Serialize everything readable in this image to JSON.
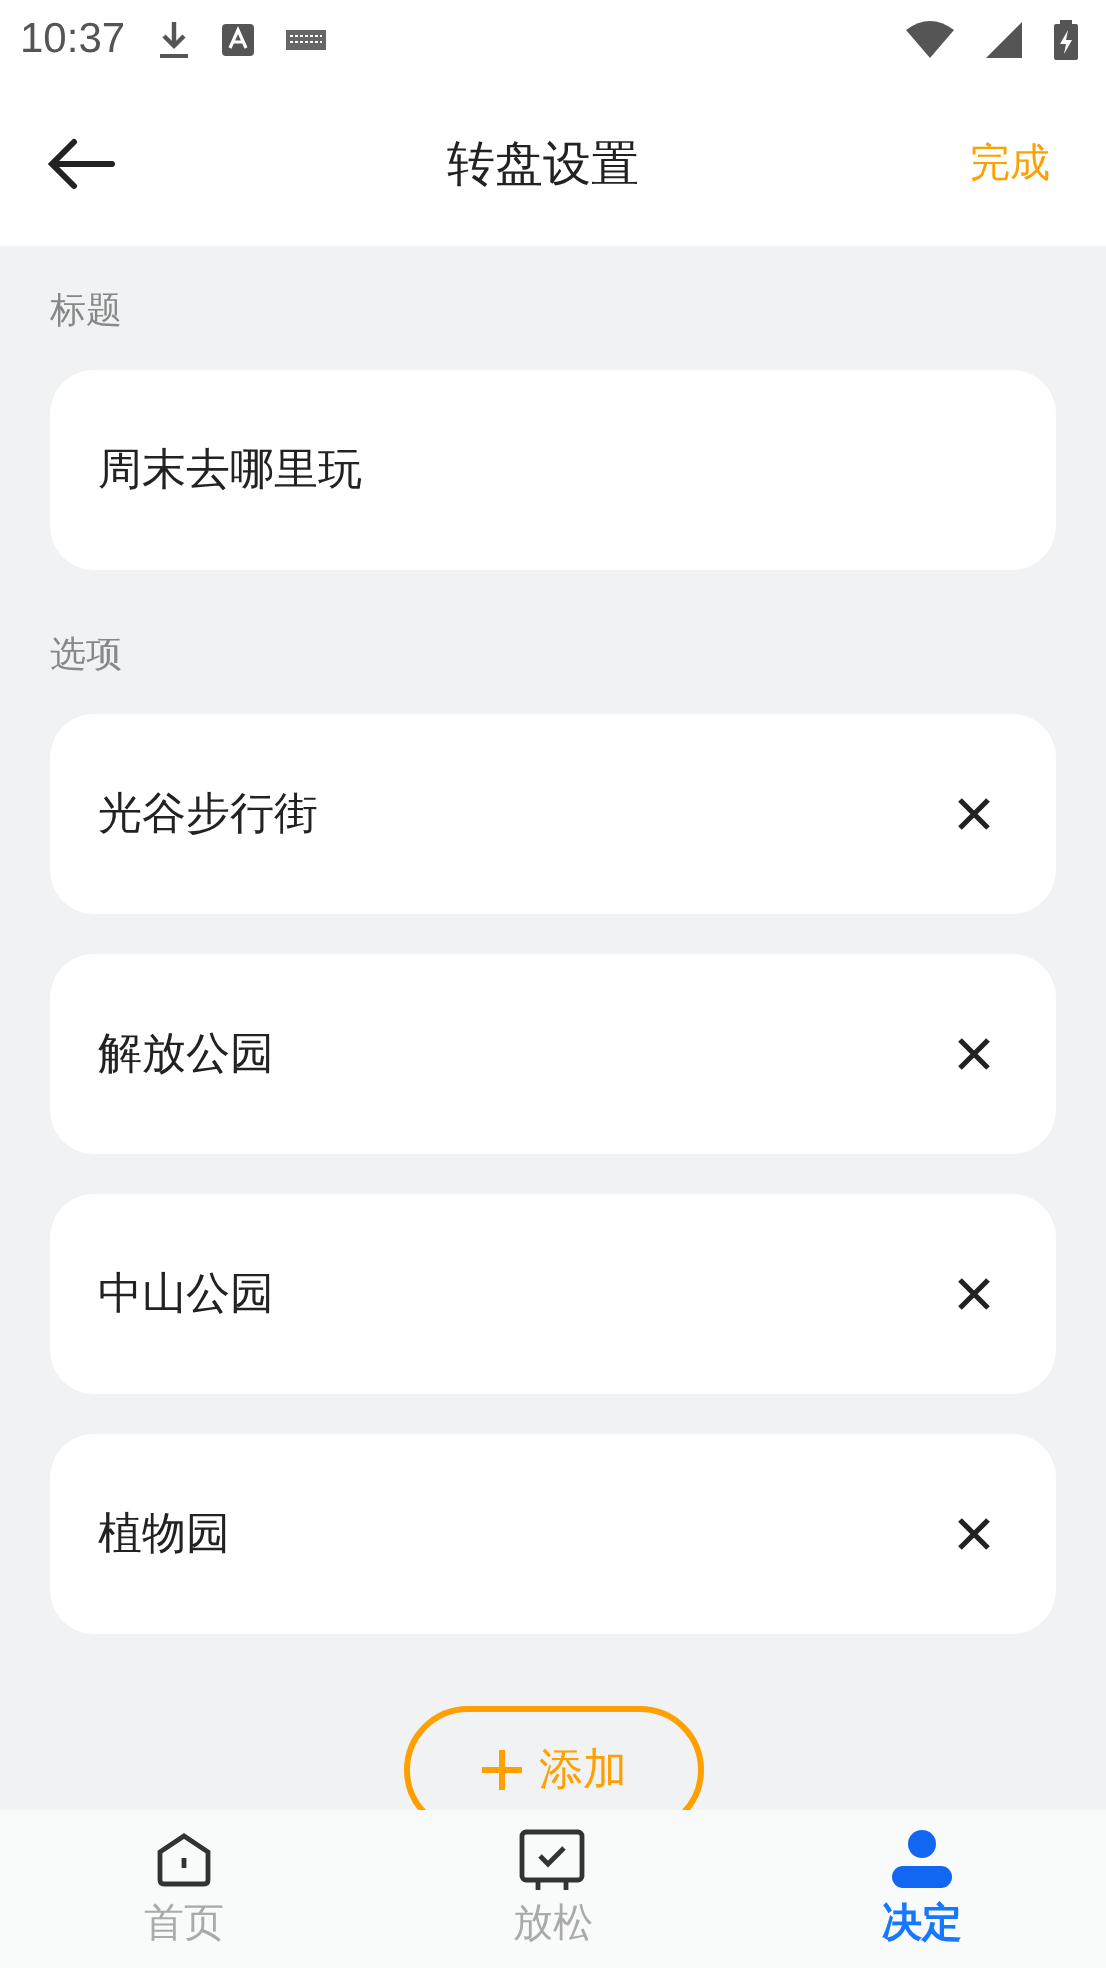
{
  "status_bar": {
    "time": "10:37"
  },
  "header": {
    "title": "转盘设置",
    "action": "完成"
  },
  "title_section": {
    "label": "标题",
    "value": "周末去哪里玩"
  },
  "options_section": {
    "label": "选项",
    "options": [
      {
        "text": "光谷步行街"
      },
      {
        "text": "解放公园"
      },
      {
        "text": "中山公园"
      },
      {
        "text": "植物园"
      }
    ]
  },
  "add_button": {
    "label": "添加"
  },
  "tabs": [
    {
      "kind": "home",
      "label": "首页",
      "selected": false
    },
    {
      "kind": "board",
      "label": "放松",
      "selected": false
    },
    {
      "kind": "person",
      "label": "决定",
      "selected": true
    }
  ]
}
